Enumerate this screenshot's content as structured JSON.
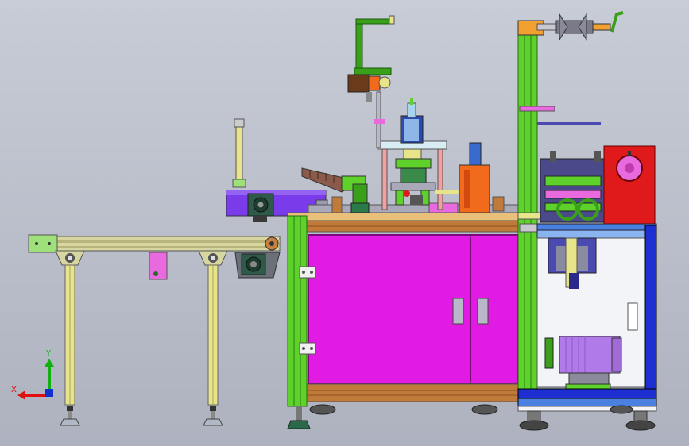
{
  "viewport": {
    "background_top": "#c8ccd6",
    "background_bottom": "#aeb2bf"
  },
  "triad": {
    "x_label": "X",
    "y_label": "Y",
    "x_color": "#e01010",
    "y_color": "#10b010",
    "z_color": "#1030d0"
  },
  "colors": {
    "cabinet_door": "#e21be4",
    "frame_green": "#5ed12b",
    "frame_yellow": "#e8e48a",
    "wood_top": "#c07a3a",
    "cabinet_blue": "#1d2fd0",
    "motor_purple": "#b07ae8",
    "control_red": "#e01a1a",
    "orange_block": "#f26a1c",
    "violet_beam": "#7a3bea",
    "conveyor_rail": "#d8d6a0",
    "panel_white": "#f2f4f8"
  }
}
